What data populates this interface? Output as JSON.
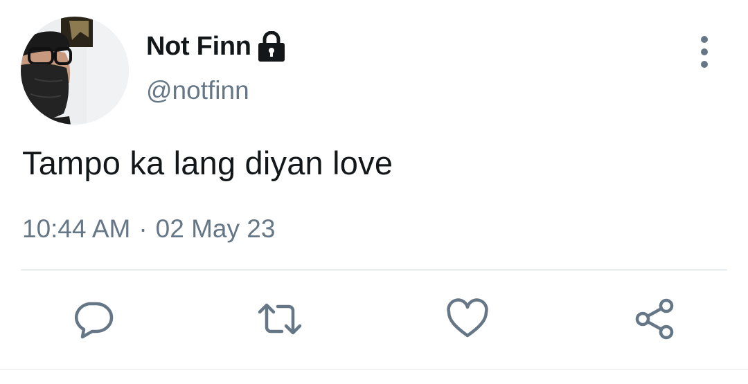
{
  "user": {
    "display_name": "Not Finn",
    "handle": "@notfinn",
    "avatar_icon": "profile-photo",
    "protected_icon": "lock-icon"
  },
  "tweet": {
    "text": "Tampo ka lang diyan love",
    "time": "10:44 AM",
    "separator": "·",
    "date": "02 May 23"
  },
  "actions": {
    "reply_icon": "reply-icon",
    "retweet_icon": "retweet-icon",
    "like_icon": "heart-icon",
    "share_icon": "share-icon",
    "more_icon": "more-vertical-icon"
  },
  "colors": {
    "primary_text": "#14171a",
    "secondary_text": "#657786",
    "divider": "#e6ecf0",
    "background": "#ffffff"
  }
}
